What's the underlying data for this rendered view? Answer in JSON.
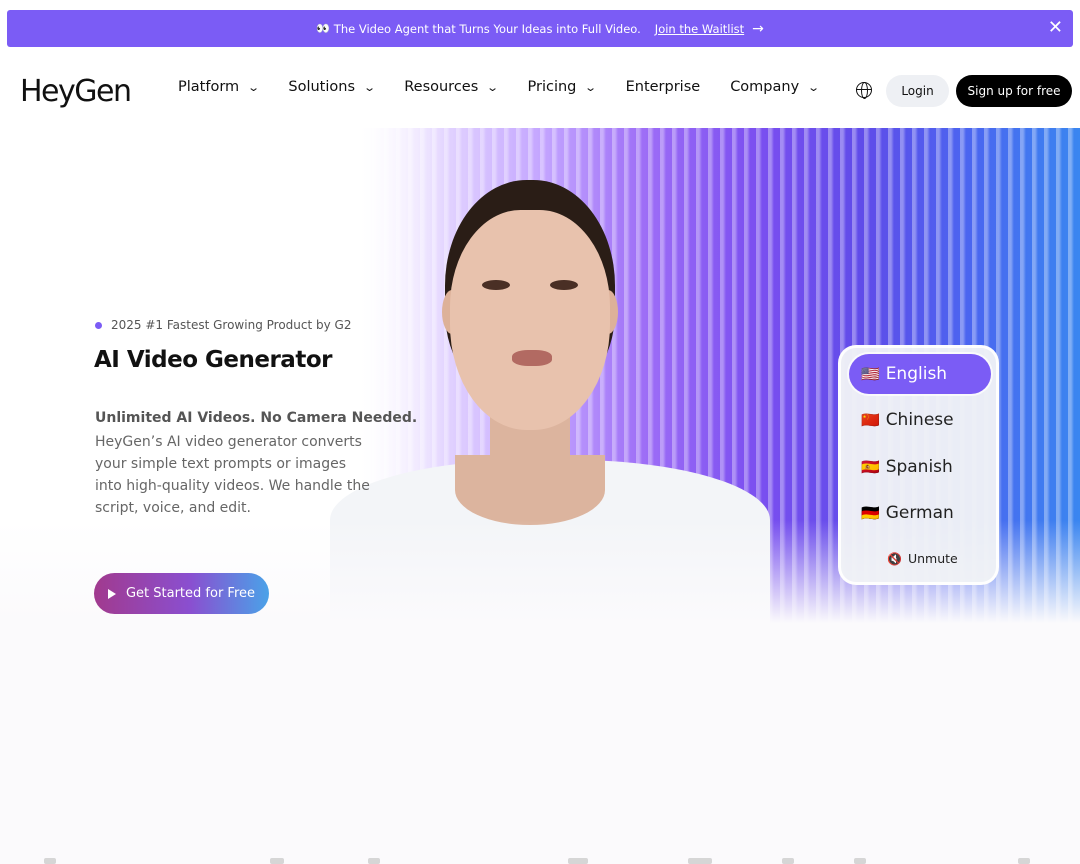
{
  "banner": {
    "eyes": "👀",
    "text": "The Video Agent that Turns Your Ideas into Full Video.",
    "link": "Join the Waitlist",
    "arrow": "→",
    "close": "✕"
  },
  "header": {
    "logo_text": "HeyGen",
    "nav": [
      {
        "label": "Platform",
        "chevron": "⌄"
      },
      {
        "label": "Solutions",
        "chevron": "⌄"
      },
      {
        "label": "Resources",
        "chevron": "⌄"
      },
      {
        "label": "Pricing",
        "chevron": "⌄"
      },
      {
        "label": "Enterprise",
        "chevron": ""
      },
      {
        "label": "Company",
        "chevron": "⌄"
      }
    ],
    "login": "Login",
    "signup": "Sign up for free"
  },
  "hero": {
    "badge": "2025 #1 Fastest Growing Product by G2",
    "title": "AI Video Generator",
    "subhead": "Unlimited AI Videos. No Camera Needed.",
    "description": "HeyGen’s AI video generator converts your simple text prompts or images into high-quality videos. We handle the script, voice, and edit.",
    "cta": "Get Started for Free"
  },
  "languages": {
    "items": [
      {
        "flag": "🇺🇸",
        "label": "English",
        "active": true
      },
      {
        "flag": "🇨🇳",
        "label": "Chinese",
        "active": false
      },
      {
        "flag": "🇪🇸",
        "label": "Spanish",
        "active": false
      },
      {
        "flag": "🇩🇪",
        "label": "German",
        "active": false
      }
    ],
    "unmute_icon": "🔇",
    "unmute": "Unmute"
  },
  "colors": {
    "accent": "#7b5cf5",
    "signup_bg": "#000000",
    "login_bg": "#eef0f4"
  }
}
